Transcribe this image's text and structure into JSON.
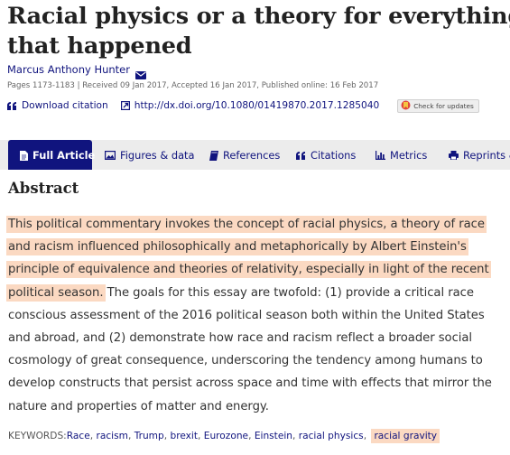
{
  "article": {
    "title_line1": "Racial physics or a theory for everything",
    "title_line2": "that happened",
    "author": "Marcus Anthony Hunter",
    "meta": "Pages 1173-1183 | Received 09 Jan 2017, Accepted 16 Jan 2017, Published online: 16 Feb 2017"
  },
  "links": {
    "download_citation": "Download citation",
    "doi": "http://dx.doi.org/10.1080/01419870.2017.1285040",
    "check_updates": "Check for updates"
  },
  "tabs": [
    {
      "label": "Full Article",
      "icon": "document-icon",
      "active": true
    },
    {
      "label": "Figures & data",
      "icon": "image-icon"
    },
    {
      "label": "References",
      "icon": "book-icon"
    },
    {
      "label": "Citations",
      "icon": "quote-icon"
    },
    {
      "label": "Metrics",
      "icon": "bar-chart-icon"
    },
    {
      "label": "Reprints &",
      "icon": "print-icon"
    }
  ],
  "abstract": {
    "heading": "Abstract",
    "highlighted_text": "This political commentary invokes the concept of racial physics, a theory of race and racism influenced philosophically and metaphorically by Albert Einstein's principle of equivalence and theories of relativity, especially in light of the recent political season.",
    "rest_text": " The goals for this essay are twofold: (1) provide a critical race conscious assessment of the 2016 political season both within the United States and abroad, and (2) demonstrate how race and racism reflect a broader social cosmology of great consequence, underscoring the tendency among humans to develop constructs that persist across space and time with effects that mirror the nature and properties of matter and energy."
  },
  "keywords": {
    "label": "KEYWORDS:",
    "items": [
      "Race",
      "racism",
      "Trump",
      "brexit",
      "Eurozone",
      "Einstein",
      "racial physics",
      "racial gravity"
    ],
    "highlighted": "racial gravity"
  },
  "colors": {
    "brand_navy": "#10147e",
    "highlight": "#fbd9c2",
    "tab_bar": "#ececec"
  }
}
